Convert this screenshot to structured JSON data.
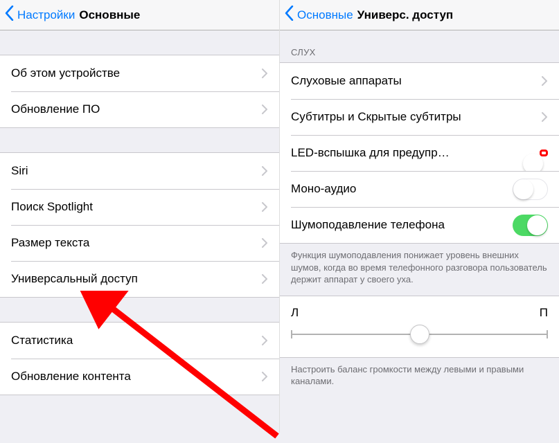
{
  "left": {
    "back": "Настройки",
    "title": "Основные",
    "group1": [
      {
        "label": "Об этом устройстве"
      },
      {
        "label": "Обновление ПО"
      }
    ],
    "group2": [
      {
        "label": "Siri"
      },
      {
        "label": "Поиск Spotlight"
      },
      {
        "label": "Размер текста"
      },
      {
        "label": "Универсальный доступ"
      }
    ],
    "group3": [
      {
        "label": "Статистика"
      },
      {
        "label": "Обновление контента"
      }
    ]
  },
  "right": {
    "back": "Основные",
    "title": "Универс. доступ",
    "section_hearing": "СЛУХ",
    "rows": [
      {
        "label": "Слуховые аппараты",
        "type": "disclosure"
      },
      {
        "label": "Субтитры и Скрытые субтитры",
        "type": "disclosure"
      },
      {
        "label": "LED-вспышка для предупр…",
        "type": "toggle",
        "on": true,
        "highlight": true
      },
      {
        "label": "Моно-аудио",
        "type": "toggle",
        "on": false
      },
      {
        "label": "Шумоподавление телефона",
        "type": "toggle",
        "on": true
      }
    ],
    "noise_footer": "Функция шумоподавления понижает уровень внешних шумов, когда во время телефонного разговора пользователь держит аппарат у своего уха.",
    "slider": {
      "left": "Л",
      "right": "П",
      "value": 0.5
    },
    "balance_footer": "Настроить баланс громкости между левыми и правыми каналами."
  }
}
